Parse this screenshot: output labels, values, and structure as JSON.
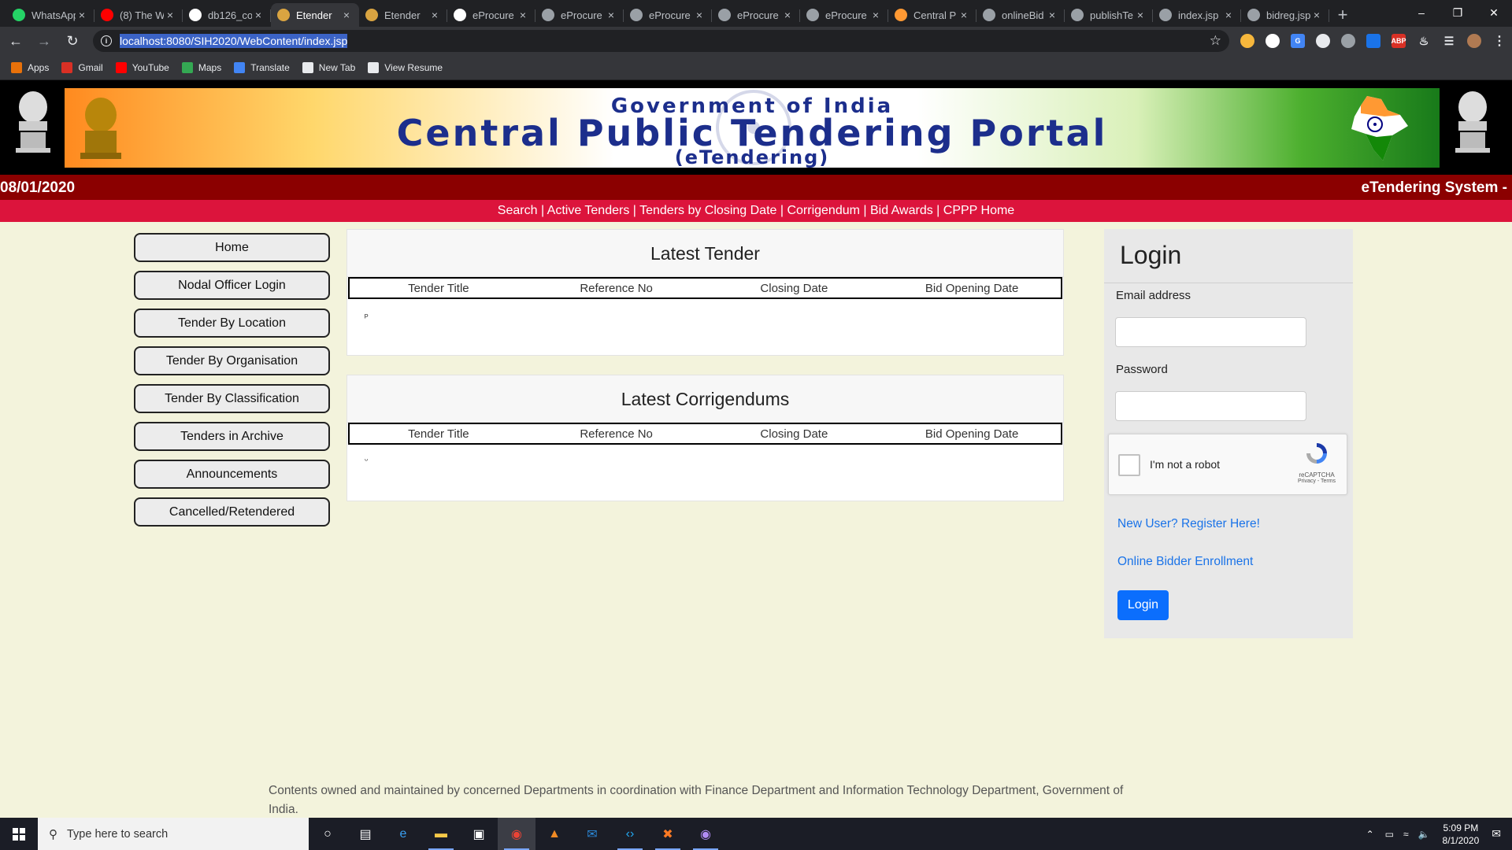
{
  "browser": {
    "tabs": [
      {
        "title": "WhatsApp",
        "icon": "whatsapp-icon",
        "color": "#25d366",
        "active": false
      },
      {
        "title": "(8) The W",
        "icon": "youtube-icon",
        "color": "#ff0000",
        "active": false
      },
      {
        "title": "db126_co",
        "icon": "github-icon",
        "color": "#ffffff",
        "active": false
      },
      {
        "title": "Etender",
        "icon": "etender-icon",
        "color": "#d9a441",
        "active": true
      },
      {
        "title": "Etender",
        "icon": "etender-icon",
        "color": "#d9a441",
        "active": false
      },
      {
        "title": "eProcure",
        "icon": "globe-icon",
        "color": "#ffffff",
        "active": false
      },
      {
        "title": "eProcure",
        "icon": "globe-icon",
        "color": "#9aa0a6",
        "active": false
      },
      {
        "title": "eProcure",
        "icon": "globe-icon",
        "color": "#9aa0a6",
        "active": false
      },
      {
        "title": "eProcure",
        "icon": "globe-icon",
        "color": "#9aa0a6",
        "active": false
      },
      {
        "title": "eProcure",
        "icon": "globe-icon",
        "color": "#9aa0a6",
        "active": false
      },
      {
        "title": "Central P",
        "icon": "india-flag-icon",
        "color": "#ff9933",
        "active": false
      },
      {
        "title": "onlineBid",
        "icon": "globe-icon",
        "color": "#9aa0a6",
        "active": false
      },
      {
        "title": "publishTe",
        "icon": "globe-icon",
        "color": "#9aa0a6",
        "active": false
      },
      {
        "title": "index.jsp",
        "icon": "globe-icon",
        "color": "#9aa0a6",
        "active": false
      },
      {
        "title": "bidreg.jsp",
        "icon": "globe-icon",
        "color": "#9aa0a6",
        "active": false
      }
    ],
    "url": "localhost:8080/SIH2020/WebContent/index.jsp",
    "bookmarks": [
      {
        "label": "Apps",
        "icon": "apps-grid-icon",
        "color": "#e8710a"
      },
      {
        "label": "Gmail",
        "icon": "gmail-icon",
        "color": "#d93025"
      },
      {
        "label": "YouTube",
        "icon": "youtube-icon",
        "color": "#ff0000"
      },
      {
        "label": "Maps",
        "icon": "maps-icon",
        "color": "#34a853"
      },
      {
        "label": "Translate",
        "icon": "translate-icon",
        "color": "#4285f4"
      },
      {
        "label": "New Tab",
        "icon": "globe-icon",
        "color": "#e8eaed"
      },
      {
        "label": "View Resume",
        "icon": "globe-icon",
        "color": "#e8eaed"
      }
    ]
  },
  "header": {
    "banner_top": "Government of India",
    "banner_title": "Central Public Tendering Portal",
    "banner_sub": "(eTendering)",
    "date": "08/01/2020",
    "system_name": "eTendering System -"
  },
  "nav": [
    "Search",
    "Active Tenders",
    "Tenders by Closing Date",
    "Corrigendum",
    "Bid Awards",
    "CPPP Home"
  ],
  "sidebar": [
    "Home",
    "Nodal Officer Login",
    "Tender By Location",
    "Tender By Organisation",
    "Tender By Classification",
    "Tenders in Archive",
    "Announcements",
    "Cancelled/Retendered"
  ],
  "tenders": {
    "title": "Latest Tender",
    "columns": [
      "Tender Title",
      "Reference No",
      "Closing Date",
      "Bid Opening Date"
    ],
    "mark": "ᴾ"
  },
  "corrigendums": {
    "title": "Latest Corrigendums",
    "columns": [
      "Tender Title",
      "Reference No",
      "Closing Date",
      "Bid Opening Date"
    ],
    "mark": "ᵕ"
  },
  "login": {
    "title": "Login",
    "email_label": "Email address",
    "password_label": "Password",
    "captcha_text": "I'm not a robot",
    "captcha_brand": "reCAPTCHA",
    "captcha_terms": "Privacy - Terms",
    "register_link": "New User? Register Here!",
    "enroll_link": "Online Bidder Enrollment",
    "button": "Login"
  },
  "footer": "Contents owned and maintained by concerned Departments in coordination with Finance Department and Information Technology Department, Government of India.",
  "taskbar": {
    "search_placeholder": "Type here to search",
    "time": "5:09 PM",
    "date": "8/1/2020",
    "apps": [
      "cortana-icon",
      "task-view-icon",
      "edge-icon",
      "file-explorer-icon",
      "store-icon",
      "chrome-icon",
      "vlc-icon",
      "mail-icon",
      "vscode-icon",
      "xampp-icon",
      "app-icon"
    ]
  }
}
